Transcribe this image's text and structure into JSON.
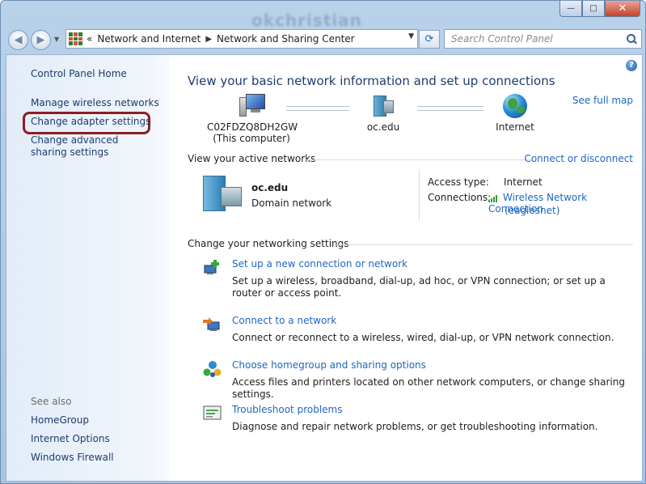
{
  "window": {
    "title": "okchristian"
  },
  "caption_buttons": {
    "minimize": "—",
    "maximize": "□",
    "close": "✕"
  },
  "nav": {
    "back_glyph": "◀",
    "forward_glyph": "▶",
    "breadcrumb": [
      "Network and Internet",
      "Network and Sharing Center"
    ],
    "overflow": "«",
    "search_placeholder": "Search Control Panel"
  },
  "left_pane": {
    "home": "Control Panel Home",
    "links": [
      "Manage wireless networks",
      "Change adapter settings",
      "Change advanced sharing settings"
    ],
    "see_also_label": "See also",
    "see_also": [
      "HomeGroup",
      "Internet Options",
      "Windows Firewall"
    ]
  },
  "main": {
    "title": "View your basic network information and set up connections",
    "see_full_map": "See full map",
    "nodes": [
      {
        "name": "C02FDZQ8DH2GW",
        "sub": "(This computer)",
        "icon": "computer-icon"
      },
      {
        "name": "oc.edu",
        "icon": "domain-network-icon"
      },
      {
        "name": "Internet",
        "icon": "globe-icon"
      }
    ],
    "active_label": "View your active networks",
    "connect_link": "Connect or disconnect",
    "network": {
      "name": "oc.edu",
      "type": "Domain network",
      "access_label": "Access type:",
      "access_value": "Internet",
      "connections_label": "Connections:",
      "connection_value": "Wireless Network Connection",
      "connection_sub": "(eaglesnet)"
    },
    "change_label": "Change your networking settings",
    "tasks": [
      {
        "link": "Set up a new connection or network",
        "desc": "Set up a wireless, broadband, dial-up, ad hoc, or VPN connection; or set up a router or access point."
      },
      {
        "link": "Connect to a network",
        "desc": "Connect or reconnect to a wireless, wired, dial-up, or VPN network connection."
      },
      {
        "link": "Choose homegroup and sharing options",
        "desc": "Access files and printers located on other network computers, or change sharing settings."
      },
      {
        "link": "Troubleshoot problems",
        "desc": "Diagnose and repair network problems, or get troubleshooting information."
      }
    ],
    "help_glyph": "?"
  }
}
